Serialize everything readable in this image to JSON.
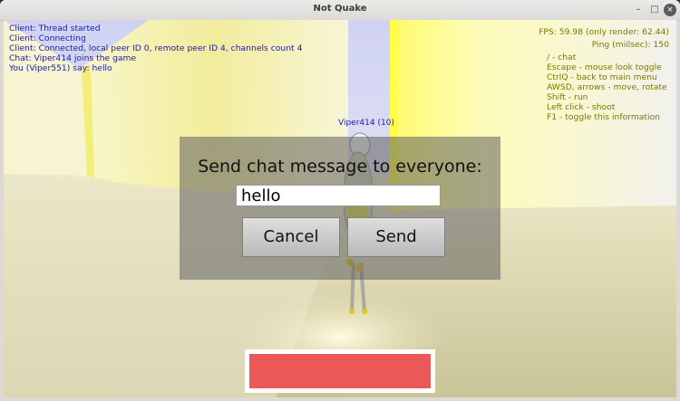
{
  "window": {
    "title": "Not Quake",
    "controls": [
      "minimize-icon",
      "maximize-icon",
      "close-icon"
    ],
    "control_glyphs": {
      "minimize": "–",
      "maximize": "□",
      "close": "×"
    }
  },
  "hud": {
    "log": [
      "Client: Thread started",
      "Client: Connecting",
      "Client: Connected, local peer ID 0, remote peer ID 4, channels count 4",
      "Chat: Viper414 joins the game",
      "You (Viper551) say: hello"
    ],
    "fps": "FPS: 59.98 (only render: 62.44)",
    "ping": "Ping (miilsec): 150",
    "help": [
      "/ - chat",
      "Escape - mouse look toggle",
      "CtrlQ - back to main menu",
      "AWSD, arrows - move, rotate",
      "Shift - run",
      "Left click - shoot",
      "F1 - toggle this information"
    ],
    "log_color": "#1a1ab0",
    "help_color": "#7a7a00"
  },
  "player": {
    "label": "Viper414 (10)"
  },
  "chat_dialog": {
    "title": "Send chat message to everyone:",
    "input_value": "hello",
    "cancel_label": "Cancel",
    "send_label": "Send"
  },
  "health": {
    "fraction": 1.0,
    "color": "#ea5858"
  }
}
